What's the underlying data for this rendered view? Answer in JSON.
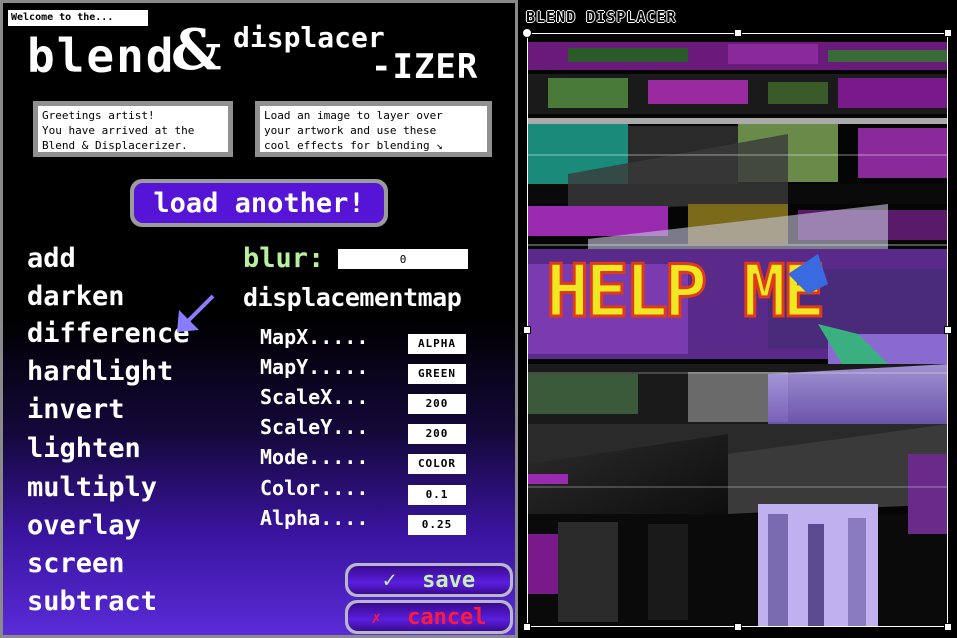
{
  "header": {
    "welcome": "Welcome to the...",
    "title_blend": "blend",
    "title_amp": "&",
    "title_displacer": "displacer",
    "title_izer": "-IZER"
  },
  "greeting_box": {
    "lines": [
      "Greetings artist!",
      "You have arrived at the",
      "Blend & Displacerizer."
    ]
  },
  "info_box": {
    "lines": [
      "Load an image to layer over",
      "your artwork and use these",
      "cool effects for blending ↘"
    ]
  },
  "load_button_label": "load another!",
  "blend_modes": [
    "add",
    "darken",
    "difference",
    "hardlight",
    "invert",
    "lighten",
    "multiply",
    "overlay",
    "screen",
    "subtract"
  ],
  "blur": {
    "label": "blur:",
    "value": "0"
  },
  "displacement": {
    "title": "displacementmap",
    "params": [
      {
        "label": "MapX.....",
        "value": "ALPHA"
      },
      {
        "label": "MapY.....",
        "value": "GREEN"
      },
      {
        "label": "ScaleX...",
        "value": "200"
      },
      {
        "label": "ScaleY...",
        "value": "200"
      },
      {
        "label": "Mode.....",
        "value": "COLOR"
      },
      {
        "label": "Color....",
        "value": "0.1"
      },
      {
        "label": "Alpha....",
        "value": "0.25"
      }
    ]
  },
  "save_button": {
    "icon": "✓",
    "label": "save"
  },
  "cancel_button": {
    "icon": "✗",
    "label": "cancel"
  },
  "canvas": {
    "header": "BLEND DISPLACER",
    "artwork_text": "HELP ME"
  },
  "colors": {
    "accent_purple": "#5514d6",
    "blur_label_green": "#b8f0a0",
    "cancel_red": "#ff1a3a",
    "panel_border": "#8a8a8a"
  }
}
